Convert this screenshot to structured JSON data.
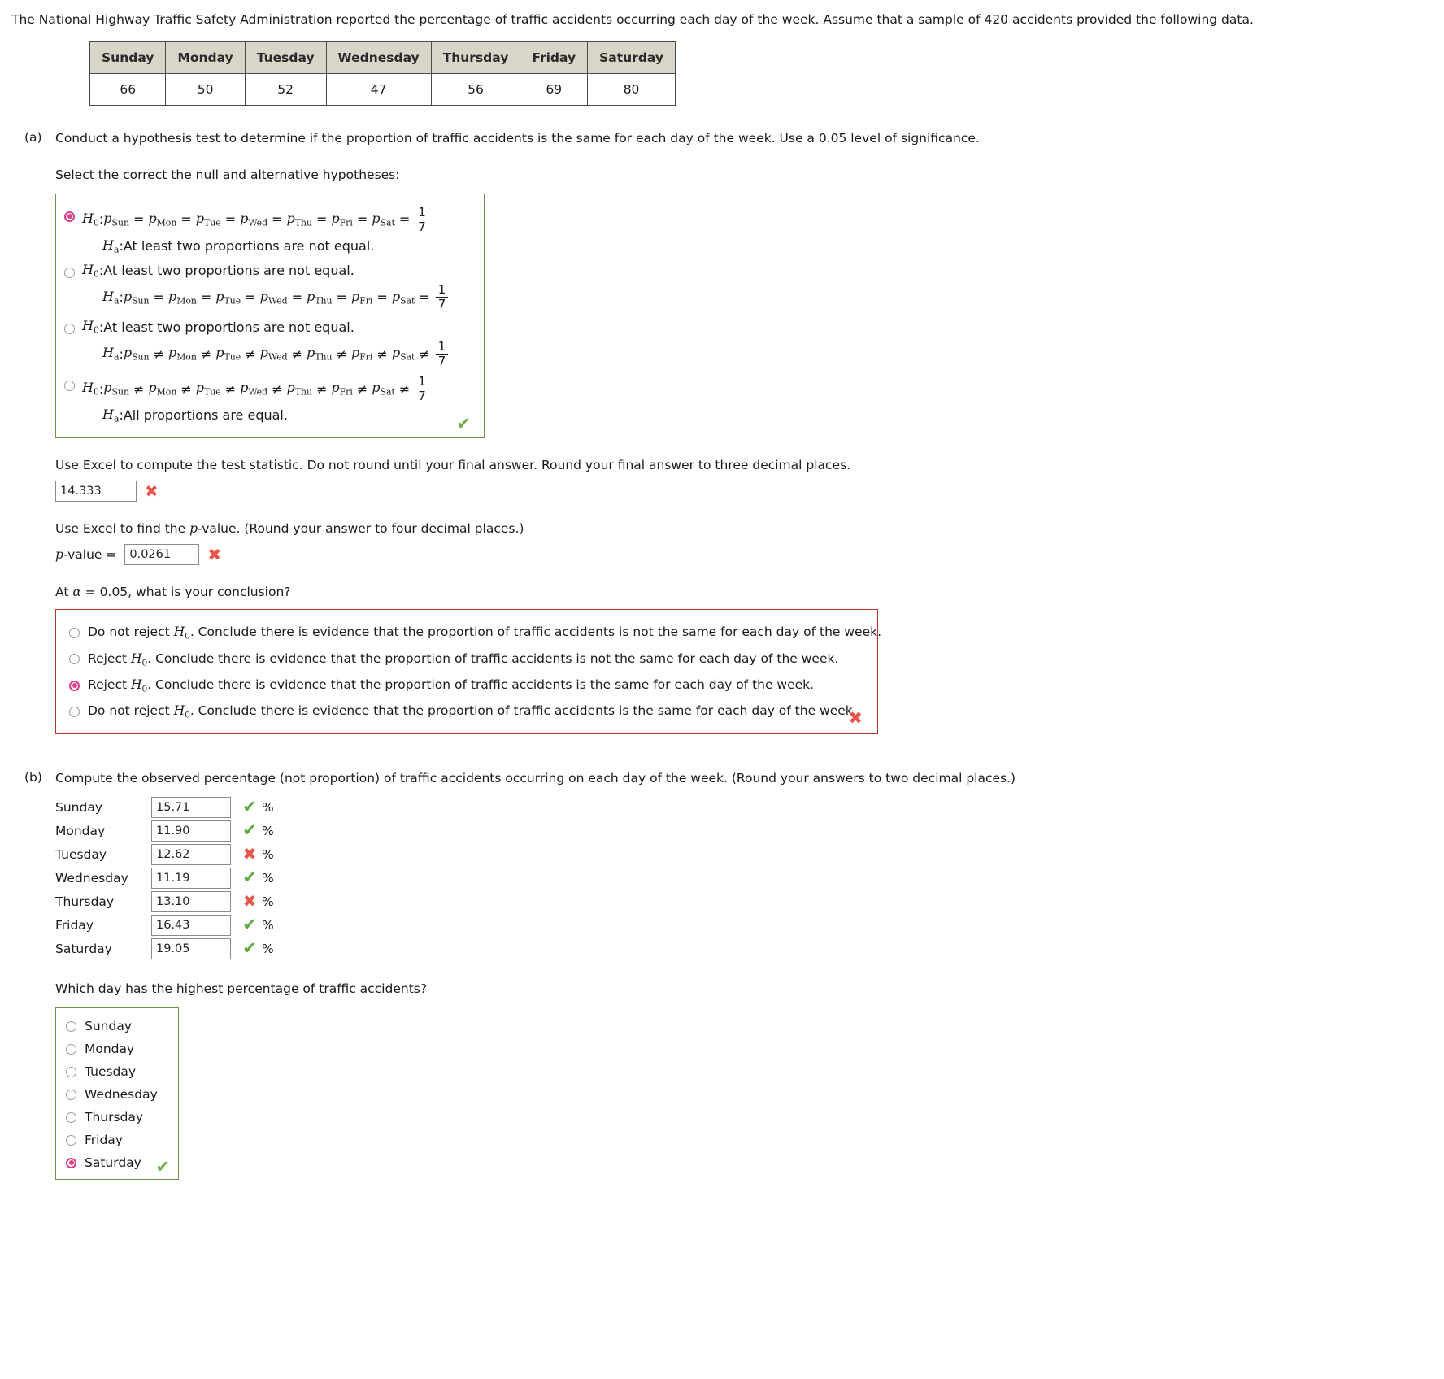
{
  "intro": {
    "text": "The National Highway Traffic Safety Administration reported the percentage of traffic accidents occurring each day of the week. Assume that a sample of 420 accidents provided the following data."
  },
  "data_table": {
    "headers": [
      "Sunday",
      "Monday",
      "Tuesday",
      "Wednesday",
      "Thursday",
      "Friday",
      "Saturday"
    ],
    "values": [
      "66",
      "50",
      "52",
      "47",
      "56",
      "69",
      "80"
    ]
  },
  "part_a": {
    "letter": "(a)",
    "prompt": "Conduct a hypothesis test to determine if the proportion of traffic accidents is the same for each day of the week. Use a 0.05 level of significance.",
    "select_prompt": "Select the correct the null and alternative hypotheses:",
    "hypotheses": {
      "days": [
        "Sun",
        "Mon",
        "Tue",
        "Wed",
        "Thu",
        "Fri",
        "Sat"
      ],
      "fraction_num": "1",
      "fraction_den": "7",
      "eq_op": "=",
      "neq_op": "≠",
      "text_at_least": "At least two proportions are not equal.",
      "text_all_equal": "All proportions are equal.",
      "h0_label": "H",
      "h0_sub": "0",
      "ha_label": "H",
      "ha_sub": "a",
      "p_symbol": "p",
      "colon": ":",
      "options": [
        {
          "id": "opt1",
          "selected": true,
          "h0_type": "chain_eq",
          "ha_type": "text_at_least"
        },
        {
          "id": "opt2",
          "selected": false,
          "h0_type": "text_at_least",
          "ha_type": "chain_eq"
        },
        {
          "id": "opt3",
          "selected": false,
          "h0_type": "text_at_least",
          "ha_type": "chain_neq"
        },
        {
          "id": "opt4",
          "selected": false,
          "h0_type": "chain_neq",
          "ha_type": "text_all_equal"
        }
      ],
      "box_status": "correct",
      "box_mark": "✔"
    },
    "test_statistic": {
      "prompt": "Use Excel to compute the test statistic. Do not round until your final answer. Round your final answer to three decimal places.",
      "value": "14.333",
      "status": "wrong",
      "mark": "✖"
    },
    "p_value": {
      "prompt": "Use Excel to find the p-value. (Round your answer to four decimal places.)",
      "prompt_prefix": "Use Excel to find the ",
      "prompt_italic": "p",
      "prompt_suffix": "-value. (Round your answer to four decimal places.)",
      "label_italic": "p",
      "label_rest": "-value =",
      "value": "0.0261",
      "status": "wrong",
      "mark": "✖"
    },
    "conclusion": {
      "prompt_prefix": "At ",
      "prompt_alpha": "α",
      "prompt_suffix": " = 0.05, what is your conclusion?",
      "options": [
        {
          "text": "Do not reject H0. Conclude there is evidence that the proportion of traffic accidents is not the same for each day of the week.",
          "lead": "Do not reject ",
          "tail": ". Conclude there is evidence that the proportion of traffic accidents is not the same for each day of the week.",
          "selected": false
        },
        {
          "text": "Reject H0. Conclude there is evidence that the proportion of traffic accidents is not the same for each day of the week.",
          "lead": "Reject ",
          "tail": ". Conclude there is evidence that the proportion of traffic accidents is not the same for each day of the week.",
          "selected": false
        },
        {
          "text": "Reject H0. Conclude there is evidence that the proportion of traffic accidents is the same for each day of the week.",
          "lead": "Reject ",
          "tail": ". Conclude there is evidence that the proportion of traffic accidents is the same for each day of the week.",
          "selected": true
        },
        {
          "text": "Do not reject H0. Conclude there is evidence that the proportion of traffic accidents is the same for each day of the week.",
          "lead": "Do not reject ",
          "tail": ". Conclude there is evidence that the proportion of traffic accidents is the same for each day of the week.",
          "selected": false
        }
      ],
      "box_status": "wrong",
      "box_mark": "✖"
    }
  },
  "part_b": {
    "letter": "(b)",
    "prompt": "Compute the observed percentage (not proportion) of traffic accidents occurring on each day of the week. (Round your answers to two decimal places.)",
    "percent_sign": "%",
    "rows": [
      {
        "day": "Sunday",
        "value": "15.71",
        "status": "correct",
        "mark": "✔"
      },
      {
        "day": "Monday",
        "value": "11.90",
        "status": "correct",
        "mark": "✔"
      },
      {
        "day": "Tuesday",
        "value": "12.62",
        "status": "wrong",
        "mark": "✖"
      },
      {
        "day": "Wednesday",
        "value": "11.19",
        "status": "correct",
        "mark": "✔"
      },
      {
        "day": "Thursday",
        "value": "13.10",
        "status": "wrong",
        "mark": "✖"
      },
      {
        "day": "Friday",
        "value": "16.43",
        "status": "correct",
        "mark": "✔"
      },
      {
        "day": "Saturday",
        "value": "19.05",
        "status": "correct",
        "mark": "✔"
      }
    ],
    "highest_question": "Which day has the highest percentage of traffic accidents?",
    "day_options": [
      {
        "label": "Sunday",
        "selected": false
      },
      {
        "label": "Monday",
        "selected": false
      },
      {
        "label": "Tuesday",
        "selected": false
      },
      {
        "label": "Wednesday",
        "selected": false
      },
      {
        "label": "Thursday",
        "selected": false
      },
      {
        "label": "Friday",
        "selected": false
      },
      {
        "label": "Saturday",
        "selected": true
      }
    ],
    "day_box_status": "correct",
    "day_box_mark": "✔"
  },
  "colors": {
    "correct_green": "#6cb04a",
    "wrong_red": "#e8554d",
    "selected_radio_pink": "#e23f8c",
    "box_green_border": "#6f8f4a",
    "box_red_border": "#b03a2e",
    "table_header_bg": "#d9d5c9"
  }
}
